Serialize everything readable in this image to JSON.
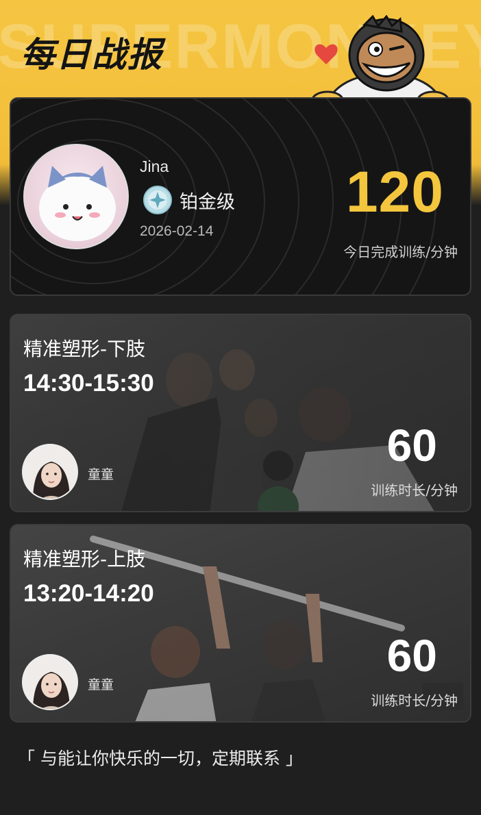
{
  "header": {
    "title": "每日战报",
    "watermark": "SUPERMONKEY"
  },
  "profile": {
    "name": "Jina",
    "level": "铂金级",
    "date": "2026-02-14",
    "total_minutes": "120",
    "total_caption": "今日完成训练/分钟"
  },
  "classes": [
    {
      "title": "精准塑形-下肢",
      "time": "14:30-15:30",
      "coach": "童童",
      "duration": "60",
      "duration_caption": "训练时长/分钟"
    },
    {
      "title": "精准塑形-上肢",
      "time": "13:20-14:20",
      "coach": "童童",
      "duration": "60",
      "duration_caption": "训练时长/分钟"
    }
  ],
  "footer": {
    "quote": "「 与能让你快乐的一切，定期联系 」"
  },
  "colors": {
    "accent": "#f4c63e",
    "background": "#1f1f1f",
    "card": "#151515"
  },
  "icons": [
    "monkey-mascot-icon",
    "heart-icon",
    "platinum-badge-icon",
    "avatar-image",
    "coach-avatar-image"
  ]
}
